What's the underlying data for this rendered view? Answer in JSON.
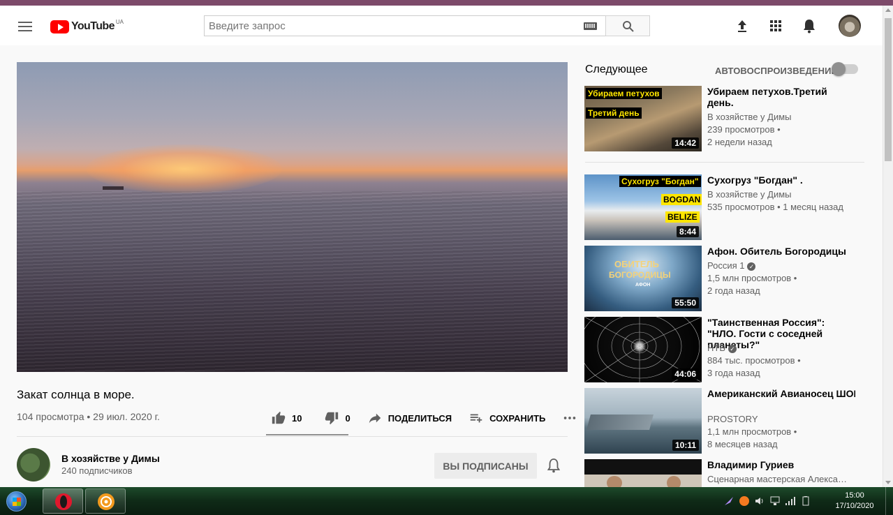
{
  "masthead": {
    "logo_text": "YouTube",
    "logo_region": "UA",
    "search_placeholder": "Введите запрос"
  },
  "video": {
    "title": "Закат солнца в море.",
    "meta": "104 просмотра • 29 июл. 2020 г.",
    "likes": "10",
    "dislikes": "0",
    "share_label": "ПОДЕЛИТЬСЯ",
    "save_label": "СОХРАНИТЬ"
  },
  "channel": {
    "name": "В хозяйстве у Димы",
    "subscribers": "240 подписчиков",
    "subscribe_label": "ВЫ ПОДПИСАНЫ"
  },
  "sidebar": {
    "up_next_label": "Следующее",
    "autoplay_label": "АВТОВОСПРОИЗВЕДЕНИЕ",
    "autoplay_on": false,
    "recommendations": [
      {
        "title": "Убираем петухов.Третий день.",
        "channel": "В хозяйстве у Димы",
        "views": "239 просмотров •",
        "age": "2 недели назад",
        "duration": "14:42",
        "thumb_labels": [
          "Убираем петухов",
          "Третий день"
        ]
      },
      {
        "title": "Сухогруз \"Богдан\" .",
        "channel": "В хозяйстве у Димы",
        "views": "535 просмотров • 1 месяц назад",
        "age": "",
        "duration": "8:44",
        "thumb_labels": [
          "Сухогруз \"Богдан\"",
          "BOGDAN",
          "BELIZE"
        ]
      },
      {
        "title": "Афон. Обитель Богородицы",
        "channel": "Россия 1",
        "verified": true,
        "views": "1,5 млн просмотров •",
        "age": "2 года назад",
        "duration": "55:50",
        "thumb_labels": [
          "ОБИТЕЛЬ",
          "БОГОРОДИЦЫ",
          "АФОН"
        ]
      },
      {
        "title": "\"Таинственная Россия\": \"НЛО. Гости с соседней планеты?\"",
        "channel": "НТВ",
        "verified": true,
        "views": "884 тыс. просмотров •",
        "age": "3 года назад",
        "duration": "44:06"
      },
      {
        "title": "Американский Авианосец ШОКИРОВАЛ Мир Своими…",
        "channel": "PROSTORY",
        "views": "1,1 млн просмотров •",
        "age": "8 месяцев назад",
        "duration": "10:11"
      },
      {
        "title": "Владимир Гуриев",
        "channel": "Сценарная мастерская Алекса…",
        "views": "",
        "age": "",
        "duration": ""
      }
    ]
  },
  "taskbar": {
    "time": "15:00",
    "date": "17/10/2020"
  },
  "colors": {
    "brand_red": "#ff0000",
    "top_strip": "#7d4a6a",
    "taskbar": "#0f2a17"
  }
}
